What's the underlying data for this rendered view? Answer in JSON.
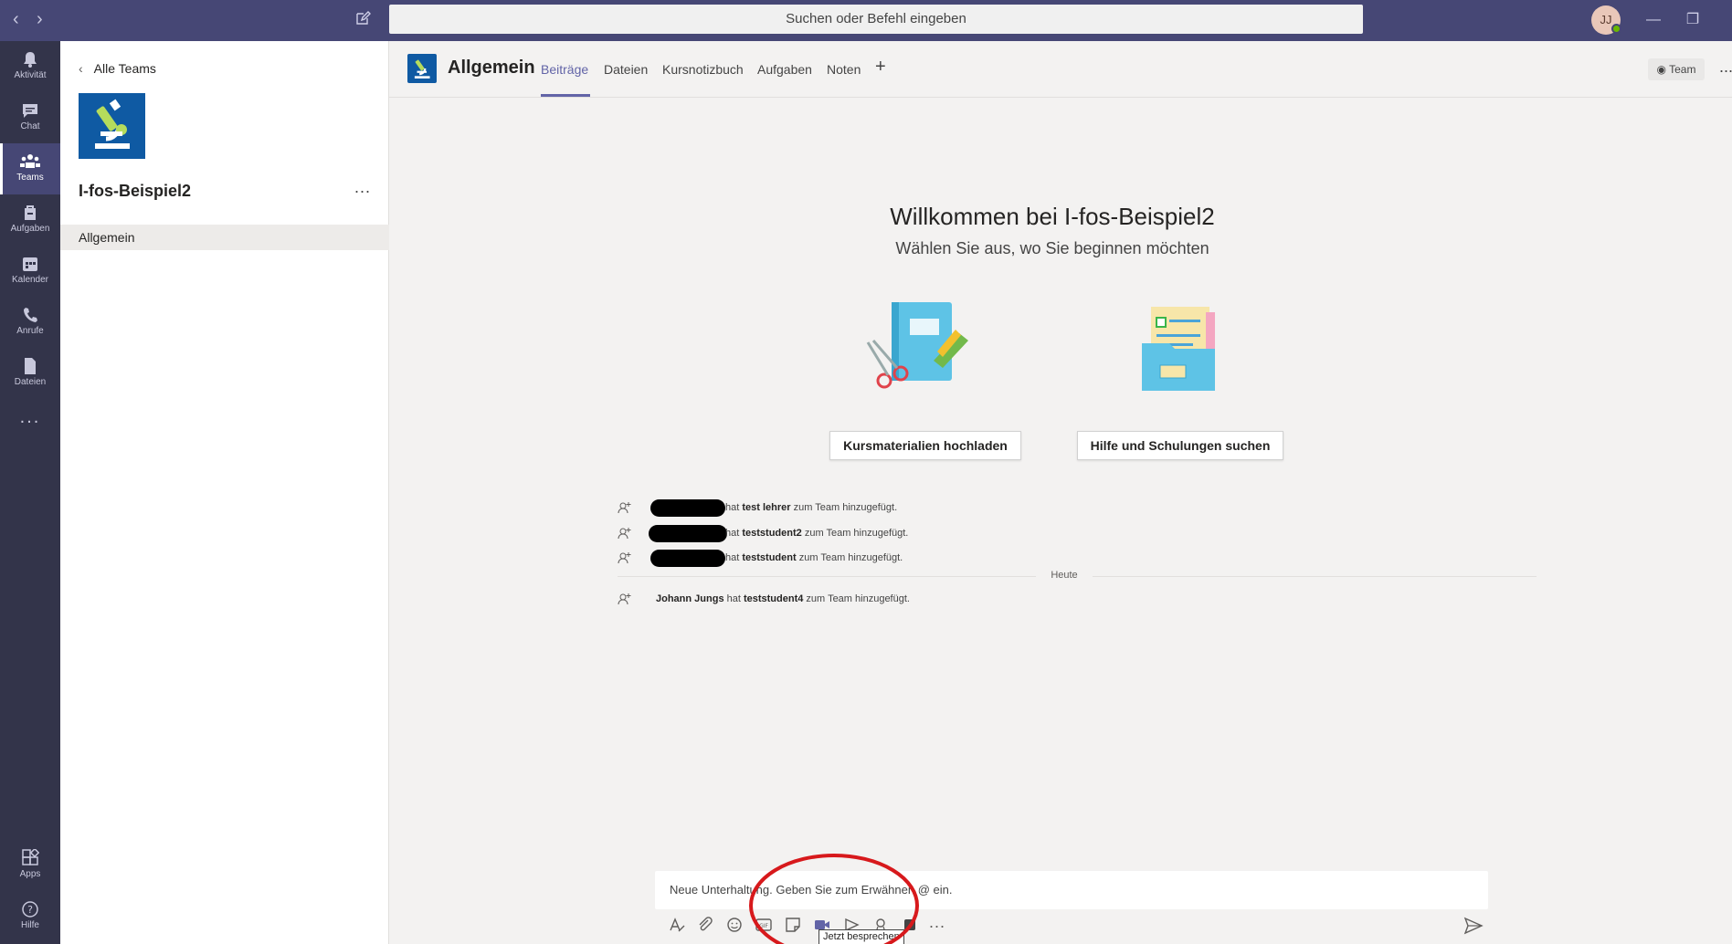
{
  "titlebar": {
    "search_placeholder": "Suchen oder Befehl eingeben",
    "avatar_initials": "JJ"
  },
  "appbar": {
    "items": [
      {
        "label": "Aktivität",
        "icon": "bell-icon"
      },
      {
        "label": "Chat",
        "icon": "chat-icon"
      },
      {
        "label": "Teams",
        "icon": "teams-icon",
        "active": true
      },
      {
        "label": "Aufgaben",
        "icon": "assignments-icon"
      },
      {
        "label": "Kalender",
        "icon": "calendar-icon"
      },
      {
        "label": "Anrufe",
        "icon": "phone-icon"
      },
      {
        "label": "Dateien",
        "icon": "file-icon"
      }
    ],
    "more": "...",
    "bottom": [
      {
        "label": "Apps",
        "icon": "apps-icon"
      },
      {
        "label": "Hilfe",
        "icon": "help-icon"
      }
    ]
  },
  "teams_pane": {
    "back_label": "Alle Teams",
    "team_name": "I-fos-Beispiel2",
    "more": "...",
    "channels": [
      "Allgemein"
    ]
  },
  "channel_header": {
    "title": "Allgemein",
    "tabs": [
      "Beiträge",
      "Dateien",
      "Kursnotizbuch",
      "Aufgaben",
      "Noten"
    ],
    "active_tab": "Beiträge",
    "add_tab": "+",
    "team_button": "Team",
    "more": "..."
  },
  "welcome": {
    "title": "Willkommen bei I-fos-Beispiel2",
    "subtitle": "Wählen Sie aus, wo Sie beginnen möchten",
    "button_upload": "Kursmaterialien hochladen",
    "button_help": "Hilfe und Schulungen suchen"
  },
  "activity": {
    "rows": [
      {
        "prefix": "hat ",
        "who": "test lehrer",
        "suffix": " zum Team hinzugefügt."
      },
      {
        "prefix": "hat ",
        "who": "teststudent2",
        "suffix": " zum Team hinzugefügt."
      },
      {
        "prefix": "hat ",
        "who": "teststudent",
        "suffix": " zum Team hinzugefügt."
      }
    ],
    "divider_label": "Heute",
    "last": {
      "actor": "Johann Jungs",
      "prefix": " hat ",
      "who": "teststudent4",
      "suffix": " zum Team hinzugefügt."
    }
  },
  "compose": {
    "placeholder": "Neue Unterhaltung. Geben Sie zum Erwähnen @ ein.",
    "tooltip": "Jetzt besprechen",
    "more": "..."
  },
  "colors": {
    "titlebar": "#464775",
    "appbar": "#33344a",
    "accent": "#6264a7",
    "annotation": "#d7191c"
  }
}
